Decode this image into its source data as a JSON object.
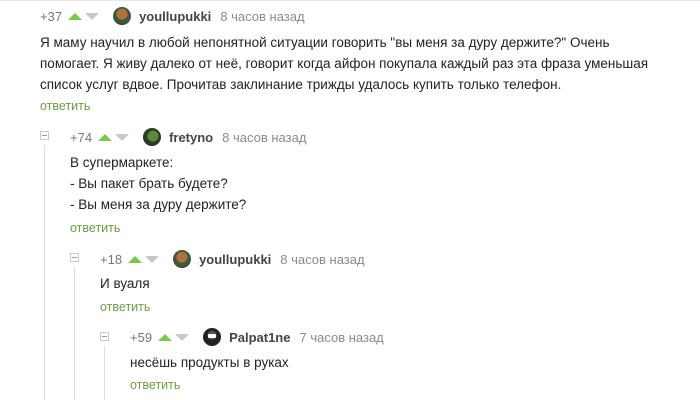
{
  "comments": [
    {
      "rating": "+37",
      "author": "youllupukki",
      "time": "8 часов назад",
      "lines": [
        "Я маму научил в любой непонятной ситуации говорить \"вы меня за дуру держите?\" Очень",
        "помогает. Я живу далеко от неё,  говорит когда айфон покупала каждый раз эта фраза уменьшая",
        "список услуг вдвое. Прочитав заклинание трижды удалось купить только телефон."
      ],
      "reply_label": "ответить"
    },
    {
      "rating": "+74",
      "author": "fretyno",
      "time": "8 часов назад",
      "lines": [
        "В супермаркете:",
        "- Вы пакет брать будете?",
        "- Вы меня за дуру держите?"
      ],
      "reply_label": "ответить"
    },
    {
      "rating": "+18",
      "author": "youllupukki",
      "time": "8 часов назад",
      "lines": [
        "И вуаля"
      ],
      "reply_label": "ответить"
    },
    {
      "rating": "+59",
      "author": "Palpat1ne",
      "time": "7 часов назад",
      "lines": [
        "несёшь продукты в руках"
      ],
      "reply_label": "ответить"
    }
  ],
  "colors": {
    "upvote": "#7cc84f",
    "downvote": "#c9c9c9",
    "reply_link": "#6f9c46",
    "thread_line": "#dedede"
  },
  "icons": {
    "upvote": "triangle-up-icon",
    "downvote": "triangle-down-icon",
    "collapse": "minus-box-icon"
  }
}
